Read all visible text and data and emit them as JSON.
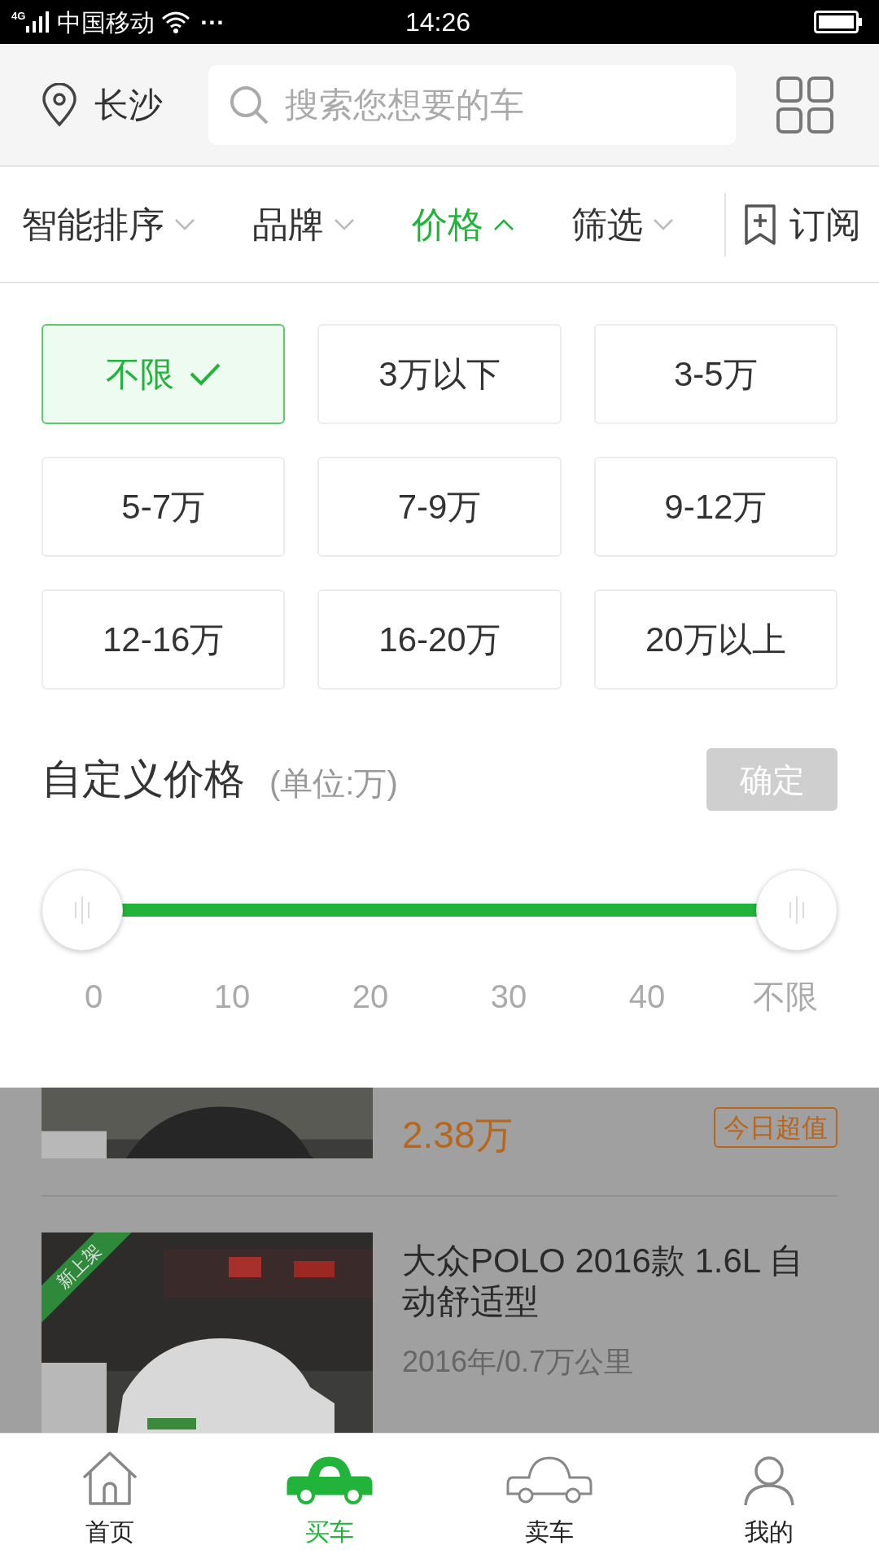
{
  "status_bar": {
    "network": "4G",
    "carrier": "中国移动",
    "dots": "···",
    "time": "14:26"
  },
  "header": {
    "city": "长沙",
    "search": {
      "placeholder": "搜索您想要的车"
    }
  },
  "filter_tabs": [
    {
      "label": "智能排序",
      "selected": false
    },
    {
      "label": "品牌",
      "selected": false
    },
    {
      "label": "价格",
      "selected": true
    },
    {
      "label": "筛选",
      "selected": false
    }
  ],
  "subscribe": {
    "label": "订阅"
  },
  "price_options": [
    {
      "label": "不限",
      "selected": true
    },
    {
      "label": "3万以下",
      "selected": false
    },
    {
      "label": "3-5万",
      "selected": false
    },
    {
      "label": "5-7万",
      "selected": false
    },
    {
      "label": "7-9万",
      "selected": false
    },
    {
      "label": "9-12万",
      "selected": false
    },
    {
      "label": "12-16万",
      "selected": false
    },
    {
      "label": "16-20万",
      "selected": false
    },
    {
      "label": "20万以上",
      "selected": false
    }
  ],
  "custom_price": {
    "title": "自定义价格",
    "unit": "(单位:万)",
    "confirm": "确定",
    "thumbs": [
      {
        "level": 0
      },
      {
        "level": 1
      }
    ],
    "ticks": [
      "0",
      "10",
      "20",
      "30",
      "40",
      "不限"
    ]
  },
  "listings": [
    {
      "price": "2.38万",
      "tags": [
        "今日超值"
      ]
    },
    {
      "badge": "新上架",
      "title": "大众POLO 2016款 1.6L 自动舒适型",
      "subtitle": "2016年/0.7万公里"
    }
  ],
  "bottom_nav": [
    {
      "label": "首页",
      "selected": false,
      "kind": "home"
    },
    {
      "label": "买车",
      "selected": true,
      "kind": "buy"
    },
    {
      "label": "卖车",
      "selected": false,
      "kind": "sell"
    },
    {
      "label": "我的",
      "selected": false,
      "kind": "me"
    }
  ]
}
